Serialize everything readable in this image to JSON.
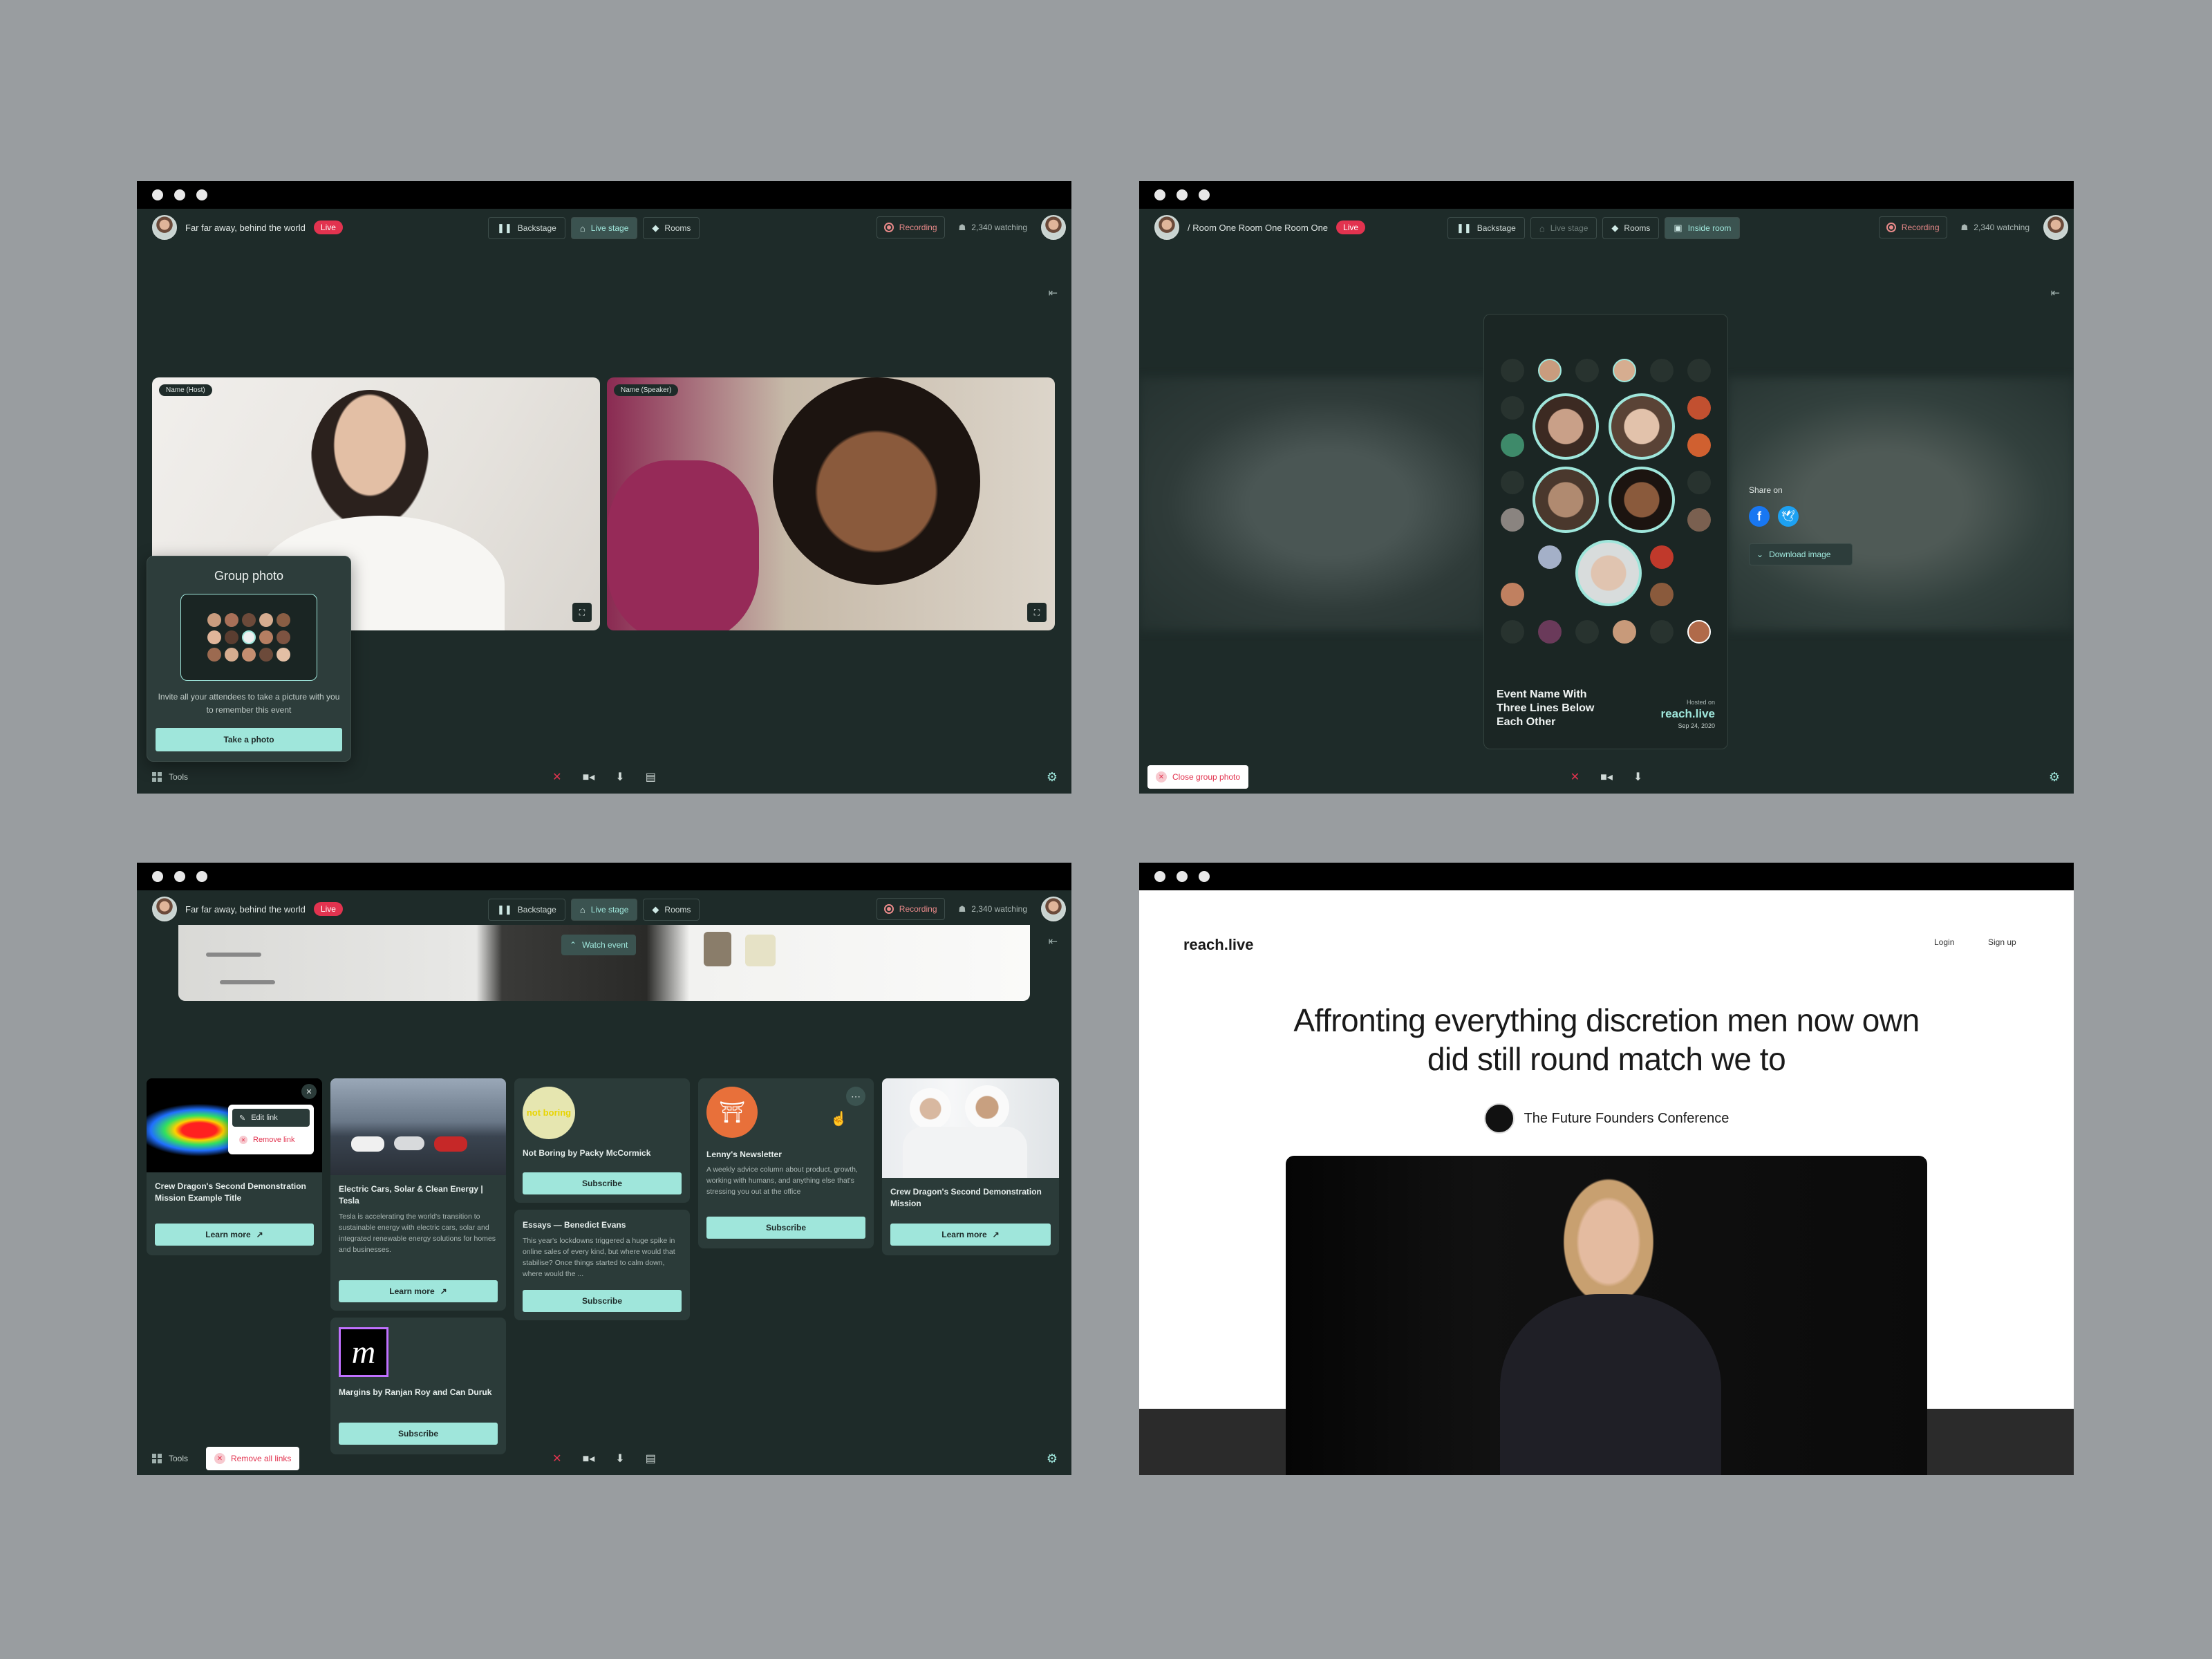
{
  "common": {
    "event_title": "Far far away, behind the world",
    "live_badge": "Live",
    "nav": {
      "backstage": "Backstage",
      "live_stage": "Live stage",
      "rooms": "Rooms",
      "inside_room": "Inside room"
    },
    "recording": "Recording",
    "watching": "2,340 watching",
    "tools": "Tools"
  },
  "window1": {
    "host_tag": "Name (Host)",
    "speaker_tag": "Name (Speaker)",
    "group_photo": {
      "title": "Group photo",
      "description": "Invite all your attendees to take a picture with you to remember this event",
      "button": "Take a photo"
    }
  },
  "window2": {
    "room_title": "/ Room One Room One Room One",
    "share_on": "Share on",
    "download_image": "Download image",
    "card_event_name": "Event Name With Three Lines Below Each Other",
    "hosted_on": "Hosted on",
    "hosted_brand": "reach.live",
    "hosted_date": "Sep 24, 2020",
    "close_group_photo": "Close group photo"
  },
  "window3": {
    "watch_event": "Watch event",
    "remove_all_links": "Remove all links",
    "context_menu": {
      "edit": "Edit link",
      "remove": "Remove link"
    },
    "cards": {
      "c1": {
        "title": "Crew Dragon's Second Demonstration Mission Example Title",
        "button": "Learn more"
      },
      "c2": {
        "title": "Electric Cars, Solar & Clean Energy | Tesla",
        "desc": "Tesla is accelerating the world's transition to sustainable energy with electric cars, solar and integrated renewable energy solutions for homes and businesses.",
        "button": "Learn more"
      },
      "c3": {
        "title": "Margins by Ranjan Roy and Can Duruk",
        "button": "Subscribe",
        "logo": "m"
      },
      "c4": {
        "title": "Not Boring by Packy McCormick",
        "button": "Subscribe",
        "logo": "not boring"
      },
      "c5": {
        "title": "Essays — Benedict Evans",
        "desc": "This year's lockdowns triggered a huge spike in online sales of every kind, but where would that stabilise? Once things started to calm down, where would the ...",
        "button": "Subscribe"
      },
      "c6": {
        "title": "Lenny's Newsletter",
        "desc": "A weekly advice column about product, growth, working with humans, and anything else that's stressing you out at the office",
        "button": "Subscribe"
      },
      "c7": {
        "title": "Crew Dragon's Second Demonstration Mission",
        "button": "Learn more"
      }
    }
  },
  "window4": {
    "brand": "reach.live",
    "login": "Login",
    "signup": "Sign up",
    "headline": "Affronting everything discretion men now own did still round match we to",
    "org": "The Future Founders Conference"
  }
}
